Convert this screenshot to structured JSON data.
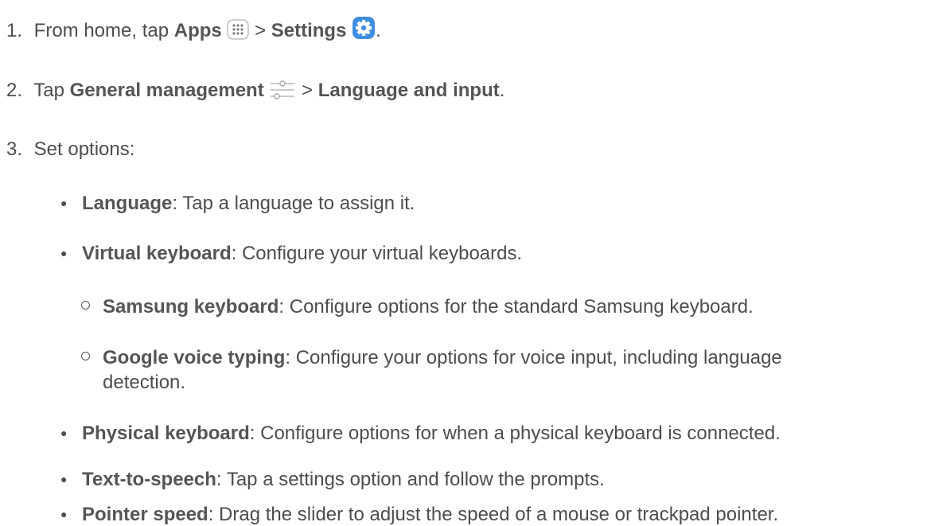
{
  "steps": [
    {
      "number": "1.",
      "pre": "From home, tap ",
      "b1": "Apps",
      "icon1": "apps-grid-icon",
      "mid": " > ",
      "b2": "Settings",
      "icon2": "settings-gear-icon",
      "post": "."
    },
    {
      "number": "2.",
      "pre": "Tap ",
      "b1": "General management",
      "icon1": "sliders-icon",
      "mid": " > ",
      "b2": "Language and input",
      "post": "."
    },
    {
      "number": "3.",
      "text": "Set options:"
    }
  ],
  "options": [
    {
      "label": "Language",
      "desc": ": Tap a language to assign it."
    },
    {
      "label": "Virtual keyboard",
      "desc": ": Configure your virtual keyboards."
    },
    {
      "label": "Physical keyboard",
      "desc": ": Configure options for when a physical keyboard is connected."
    },
    {
      "label": "Text-to-speech",
      "desc": ": Tap a settings option and follow the prompts."
    },
    {
      "label": "Pointer speed",
      "desc": ": Drag the slider to adjust the speed of a mouse or trackpad pointer."
    }
  ],
  "sub_options": [
    {
      "label": "Samsung keyboard",
      "desc": ": Configure options for the standard Samsung keyboard."
    },
    {
      "label": "Google voice typing",
      "desc": ": Configure your options for voice input, including language",
      "desc_cont": "detection."
    }
  ],
  "colors": {
    "text": "#4d4d4d",
    "settings_icon": "#3f8fe0",
    "icon_gray": "#9a9a9a"
  }
}
